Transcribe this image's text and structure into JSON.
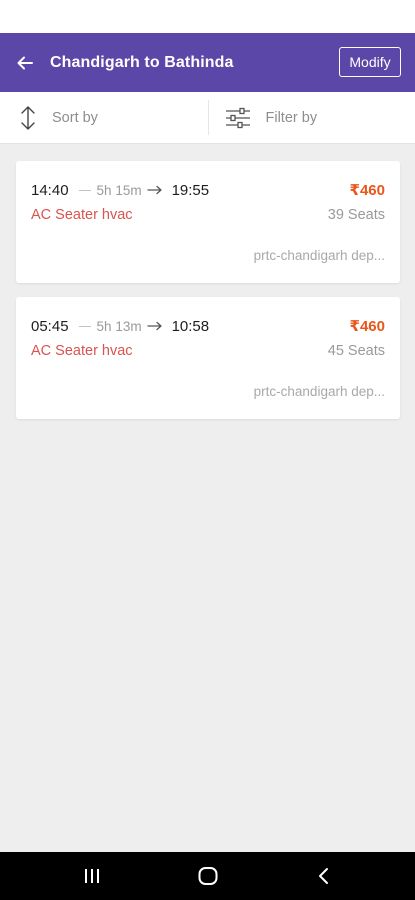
{
  "header": {
    "title": "Chandigarh to Bathinda",
    "modify_label": "Modify",
    "back_icon": "arrow-left-icon"
  },
  "toolbar": {
    "sort_label": "Sort by",
    "filter_label": "Filter by",
    "sort_icon": "sort-vertical-icon",
    "filter_icon": "sliders-icon"
  },
  "results": [
    {
      "departure": "14:40",
      "duration": "5h 15m",
      "arrival": "19:55",
      "fare": "₹460",
      "bus_type": "AC Seater hvac",
      "seats": "39 Seats",
      "operator": "prtc-chandigarh dep..."
    },
    {
      "departure": "05:45",
      "duration": "5h 13m",
      "arrival": "10:58",
      "fare": "₹460",
      "bus_type": "AC Seater hvac",
      "seats": "45 Seats",
      "operator": "prtc-chandigarh dep..."
    }
  ],
  "colors": {
    "app_bar": "#5b47a8",
    "fare": "#e8571a",
    "bus_type": "#d9534f",
    "background": "#eeeeee"
  }
}
